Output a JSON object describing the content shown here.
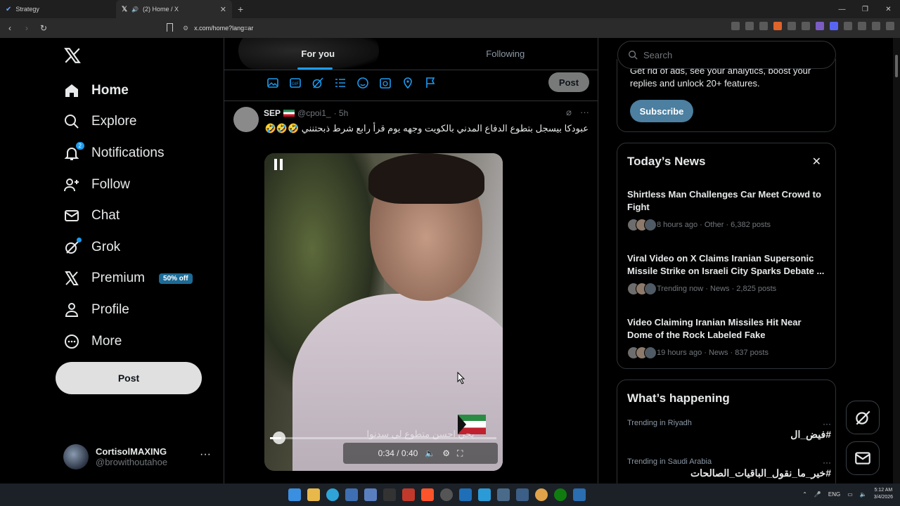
{
  "browser": {
    "tabs": [
      {
        "title": "Strategy"
      },
      {
        "title": "(2) Home / X"
      }
    ],
    "url": "x.com/home?lang=ar"
  },
  "nav": {
    "items": [
      {
        "label": "Home",
        "icon": "home-icon"
      },
      {
        "label": "Explore",
        "icon": "search-icon"
      },
      {
        "label": "Notifications",
        "icon": "bell-icon",
        "badge": "2"
      },
      {
        "label": "Follow",
        "icon": "follow-icon"
      },
      {
        "label": "Chat",
        "icon": "mail-icon"
      },
      {
        "label": "Grok",
        "icon": "grok-icon"
      },
      {
        "label": "Premium",
        "icon": "x-icon",
        "promo": "50% off"
      },
      {
        "label": "Profile",
        "icon": "person-icon"
      },
      {
        "label": "More",
        "icon": "more-circle-icon"
      }
    ],
    "post_label": "Post",
    "account": {
      "name": "CortisolMAXING",
      "handle": "@browithoutahoe"
    }
  },
  "feed": {
    "tabs": [
      {
        "label": "For you"
      },
      {
        "label": "Following"
      }
    ],
    "composer_post_label": "Post",
    "tweet": {
      "name": "SEP",
      "handle": "@cpoi1_",
      "time": "· 5h",
      "text": "عبودكا بيسجل بتطوع الدفاع المدني بالكويت وجهه يوم قرأ رابع شرط ذبحتنني 🤣🤣🤣",
      "video": {
        "time": "0:34 / 0:40",
        "subtitle": "بحي احسن متطوع لى سدنوا",
        "progress": 0.05
      }
    }
  },
  "sidebar": {
    "search_placeholder": "Search",
    "premium_text": "Get rid of ads, see your analytics, boost your replies and unlock 20+ features.",
    "subscribe_label": "Subscribe",
    "news_title": "Today’s News",
    "news": [
      {
        "headline": "Shirtless Man Challenges Car Meet Crowd to Fight",
        "meta": "8 hours ago · Other · 6,382 posts"
      },
      {
        "headline": "Viral Video on X Claims Iranian Supersonic Missile Strike on Israeli City Sparks Debate ...",
        "meta": "Trending now · News · 2,825 posts"
      },
      {
        "headline": "Video Claiming Iranian Missiles Hit Near Dome of the Rock Labeled Fake",
        "meta": "19 hours ago · News · 837 posts"
      }
    ],
    "happening_title": "What’s happening",
    "trends": [
      {
        "category": "Trending in Riyadh",
        "tag": "#فيض_ال"
      },
      {
        "category": "Trending in Saudi Arabia",
        "tag": "#خير_ما_نقول_الباقيات_الصالحات"
      }
    ]
  },
  "taskbar": {
    "lang": "ENG",
    "time": "5:12 AM",
    "date": "3/4/2026"
  },
  "colors": {
    "accent": "#1d9bf0",
    "background": "#000000",
    "border": "#2f3336"
  }
}
